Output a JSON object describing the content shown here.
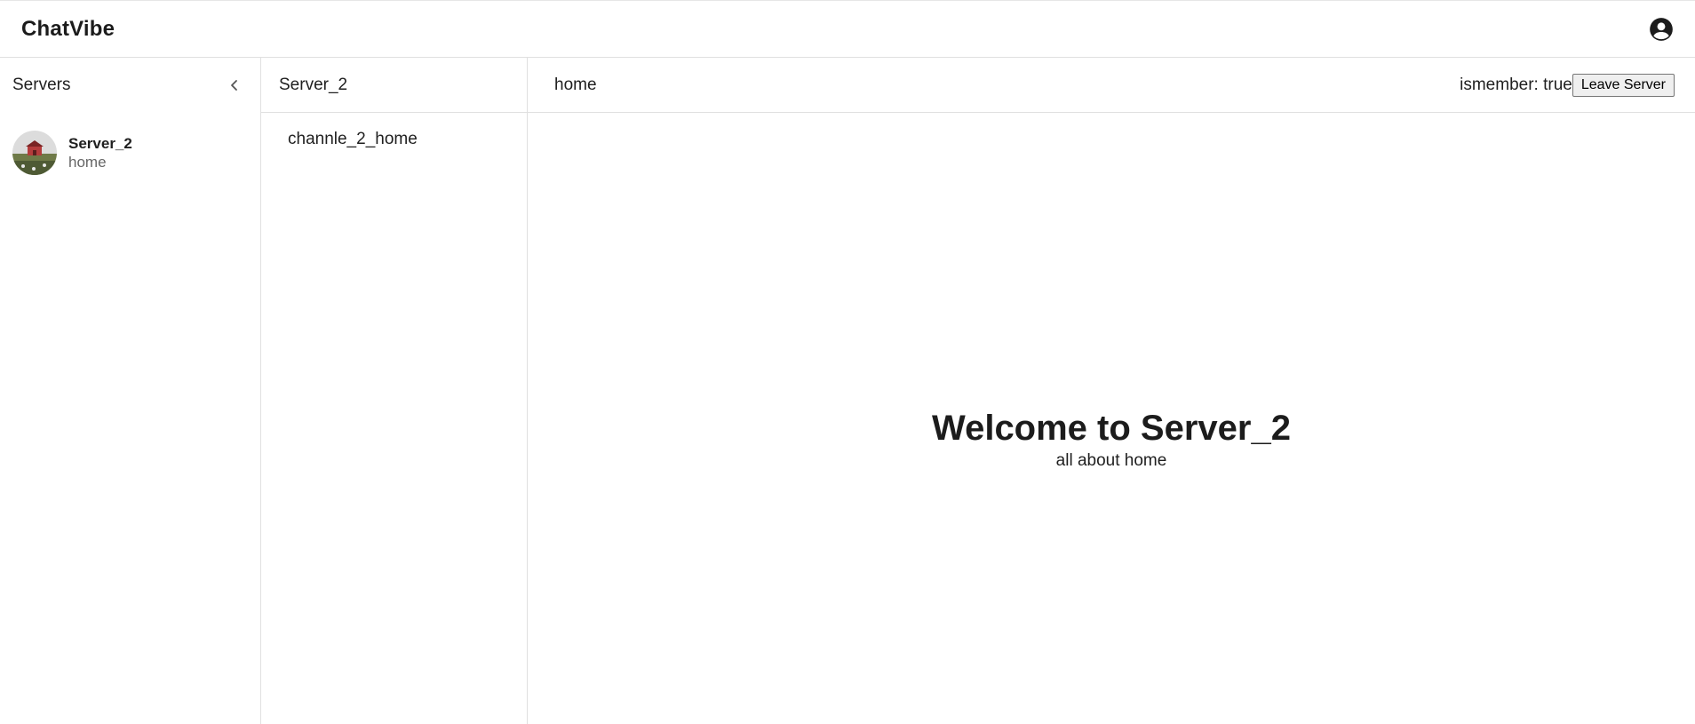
{
  "app": {
    "title": "ChatVibe"
  },
  "header": {
    "account_icon": "account-circle-icon"
  },
  "servers_panel": {
    "title": "Servers",
    "collapse_icon": "chevron-left-icon",
    "items": [
      {
        "name": "Server_2",
        "subtitle": "home",
        "avatar": "server-avatar-image"
      }
    ]
  },
  "channels_panel": {
    "title": "Server_2",
    "channels": [
      "channle_2_home"
    ]
  },
  "main": {
    "channel_title": "home",
    "member_status": "ismember: true",
    "leave_button": "Leave Server",
    "welcome_title": "Welcome to Server_2",
    "welcome_subtitle": "all about home"
  }
}
